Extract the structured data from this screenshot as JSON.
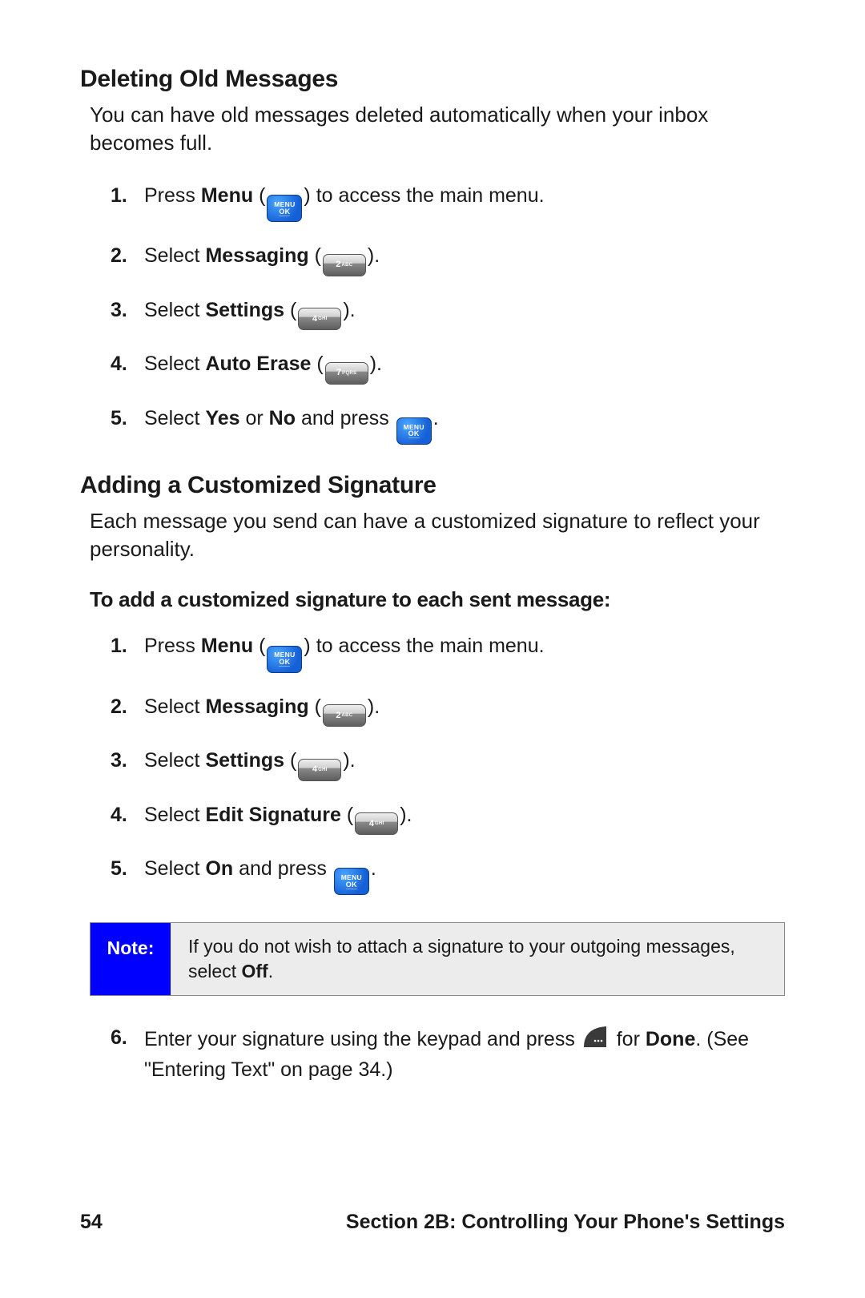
{
  "section1": {
    "heading": "Deleting Old Messages",
    "intro": "You can have old messages deleted automatically when your inbox becomes full.",
    "steps": [
      {
        "pre": "Press ",
        "bold": "Menu",
        "icon": "menu-ok",
        "post": " to access the main menu."
      },
      {
        "pre": "Select ",
        "bold": "Messaging",
        "icon": "key-2abc",
        "post": "."
      },
      {
        "pre": "Select ",
        "bold": "Settings",
        "icon": "key-4ghi",
        "post": "."
      },
      {
        "pre": "Select ",
        "bold": "Auto Erase",
        "icon": "key-7pqrs",
        "post": "."
      },
      {
        "pre": "Select ",
        "bold": "Yes",
        "mid": " or ",
        "bold2": "No",
        "mid2": " and press ",
        "icon_trail": "menu-ok",
        "post": "."
      }
    ]
  },
  "section2": {
    "heading": "Adding a Customized Signature",
    "intro": "Each message you send can have a customized signature to reflect your personality.",
    "subhead": "To add a customized signature to each sent message:",
    "stepsA": [
      {
        "pre": "Press ",
        "bold": "Menu",
        "icon": "menu-ok",
        "post": " to access the main menu."
      },
      {
        "pre": "Select ",
        "bold": "Messaging",
        "icon": "key-2abc",
        "post": "."
      },
      {
        "pre": "Select ",
        "bold": "Settings",
        "icon": "key-4ghi",
        "post": "."
      },
      {
        "pre": "Select ",
        "bold": "Edit Signature",
        "icon": "key-4ghi",
        "post": "."
      },
      {
        "pre": "Select ",
        "bold": "On",
        "mid": " and press ",
        "icon_trail": "menu-ok",
        "post": "."
      }
    ],
    "note": {
      "label": "Note:",
      "body_pre": "If you do not wish to attach a signature to your outgoing messages, select ",
      "body_bold": "Off",
      "body_post": "."
    },
    "step6": {
      "num": "6.",
      "pre": "Enter your signature using the keypad and press ",
      "icon": "softkey",
      "mid": " for ",
      "bold": "Done",
      "post": ". (See \"Entering Text\" on page 34.)"
    }
  },
  "footer": {
    "page": "54",
    "title": "Section 2B: Controlling Your Phone's Settings"
  },
  "keys": {
    "menu_l1": "MENU",
    "menu_l2": "OK",
    "k2_d": "2",
    "k2_l": "ABC",
    "k4_d": "4",
    "k4_l": "GHI",
    "k7_d": "7",
    "k7_l": "PQRS"
  }
}
